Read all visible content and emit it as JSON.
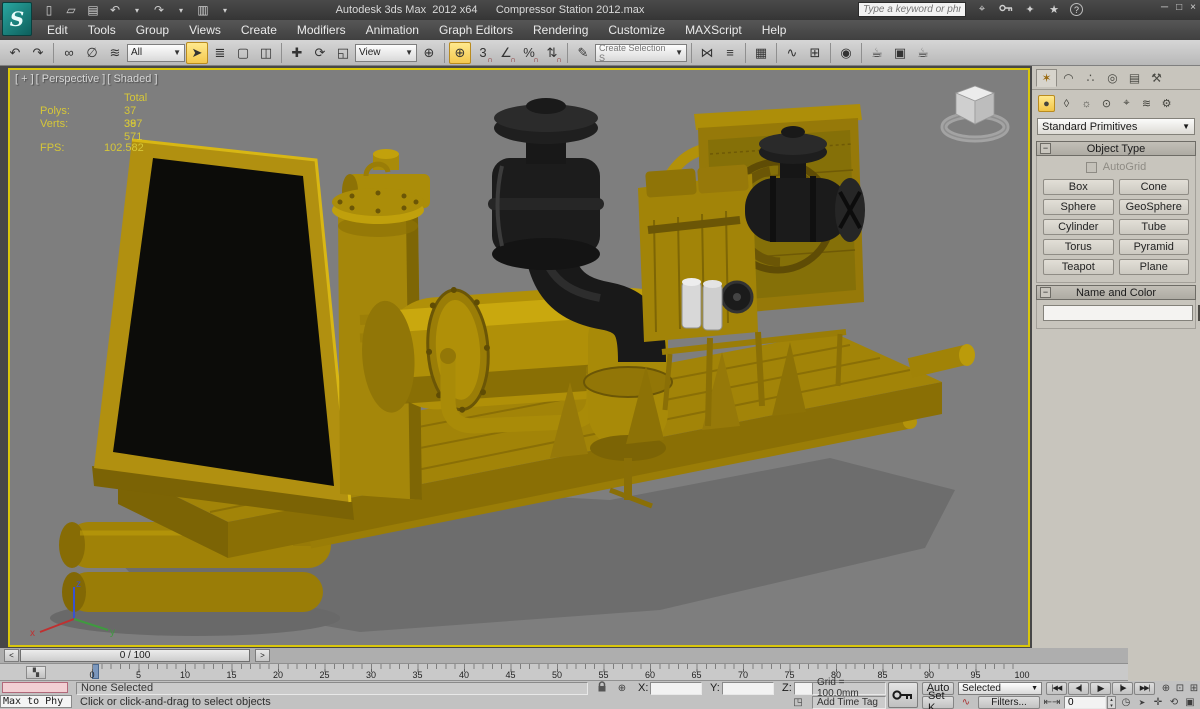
{
  "window": {
    "app_title": "Autodesk 3ds Max  2012 x64",
    "doc_title": "Compressor Station 2012.max"
  },
  "search": {
    "placeholder": "Type a keyword or phrase"
  },
  "menu": {
    "items": [
      "Edit",
      "Tools",
      "Group",
      "Views",
      "Create",
      "Modifiers",
      "Animation",
      "Graph Editors",
      "Rendering",
      "Customize",
      "MAXScript",
      "Help"
    ]
  },
  "toolbar": {
    "selection_filter": "All",
    "ref_coord_system": "View",
    "selection_set": "Create Selection S"
  },
  "viewport": {
    "label_menu": "[ + ]",
    "label_pov": "[ Perspective ]",
    "label_shading": "[ Shaded ]",
    "stats": {
      "total_label": "Total",
      "polys_label": "Polys:",
      "polys_value": "37 397",
      "verts_label": "Verts:",
      "verts_value": "38 571",
      "fps_label": "FPS:",
      "fps_value": "102.582"
    },
    "axis": {
      "x": "x",
      "y": "y",
      "z": "z"
    }
  },
  "command_panel": {
    "category_dropdown": "Standard Primitives",
    "object_type": {
      "title": "Object Type",
      "autogrid_label": "AutoGrid",
      "buttons": [
        "Box",
        "Cone",
        "Sphere",
        "GeoSphere",
        "Cylinder",
        "Tube",
        "Torus",
        "Pyramid",
        "Teapot",
        "Plane"
      ]
    },
    "name_color": {
      "title": "Name and Color",
      "name_value": "",
      "swatch_color": "#911a3e"
    }
  },
  "timeline": {
    "current_frame": "0 / 100",
    "prev_arrow": "<",
    "next_arrow": ">",
    "labels": [
      "0",
      "5",
      "10",
      "15",
      "20",
      "25",
      "30",
      "35",
      "40",
      "45",
      "50",
      "55",
      "60",
      "65",
      "70",
      "75",
      "80",
      "85",
      "90",
      "95",
      "100"
    ]
  },
  "statusbar": {
    "maxscript_line": "Max to Phy",
    "selection_status": "None Selected",
    "prompt": "Click or click-and-drag to select objects",
    "x_label": "X:",
    "y_label": "Y:",
    "z_label": "Z:",
    "coord_x": "",
    "coord_y": "",
    "coord_z": "",
    "grid_value": "Grid = 100,0mm",
    "add_time_tag": "Add Time Tag",
    "auto_key": "Auto",
    "set_key": "Set K.",
    "selected_dropdown": "Selected",
    "filters": "Filters...",
    "frame_value": "0"
  },
  "icons": {
    "logo": "S",
    "new": "▯",
    "open": "▱",
    "save": "▤",
    "undo": "↶",
    "redo": "↷",
    "caret": "▾",
    "project": "▥",
    "search_go": "⌖",
    "comm_center": "✦",
    "favorites": "★",
    "help": "?",
    "minimize": "─",
    "restore": "□",
    "close": "×",
    "link": "∞",
    "unlink": "∅",
    "bind_sw": "≋",
    "select": "➤",
    "select_by_name": "≣",
    "rect_region": "▢",
    "window_crossing": "◫",
    "move": "✚",
    "rotate": "⟳",
    "scale": "◱",
    "manipulate": "⊕",
    "snap3": "3",
    "magnet": "∩",
    "angle_snap": "∠",
    "percent_snap": "%",
    "spinner_snap": "⇅",
    "named_sel": "✎",
    "mirror": "⋈",
    "align": "≡",
    "layers": "▦",
    "curve_editor": "∿",
    "schematic": "⊞",
    "material": "◉",
    "render_setup": "☕",
    "render_frame": "▣",
    "render": "☕",
    "goto_start": "|◀◀",
    "prev_frame": "◀||",
    "play": "▶",
    "next_frame": "||▶",
    "goto_end": "▶▶|",
    "zoom": "⊕",
    "zoom_all": "⊟",
    "zoom_extents": "⊡",
    "zoom_extents_all": "⊞",
    "key_mode": "⇤⇥",
    "time_config": "◷",
    "sel_arrow": "➤",
    "pan": "✛",
    "orbit": "⟲",
    "maximize": "▣",
    "abs_offset": "⊕",
    "time_tag_icon": "◳",
    "mini_curve": "▚",
    "curve_red": "∿",
    "spin_up": "▴",
    "spin_down": "▾",
    "drop_arrow": "▼",
    "tab_create": "✶",
    "tab_modify": "◠",
    "tab_hierarchy": "∴",
    "tab_motion": "◎",
    "tab_display": "▤",
    "tab_utilities": "⚒",
    "cat_geometry": "●",
    "cat_shapes": "◊",
    "cat_lights": "☼",
    "cat_cameras": "⊙",
    "cat_helpers": "⌖",
    "cat_spacewarps": "≋",
    "cat_systems": "⚙"
  }
}
